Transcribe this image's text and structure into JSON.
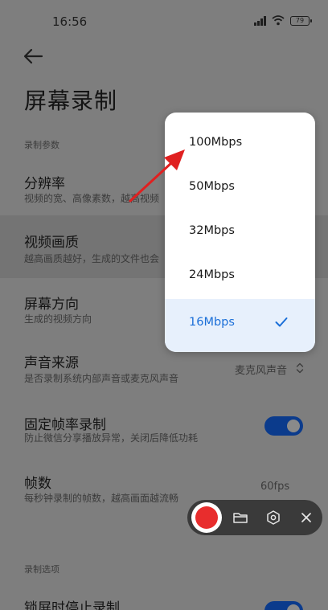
{
  "status_bar": {
    "time": "16:56",
    "battery": "79"
  },
  "page": {
    "title": "屏幕录制"
  },
  "sections": {
    "params_label": "录制参数",
    "options_label": "录制选项"
  },
  "rows": {
    "resolution": {
      "title": "分辨率",
      "desc": "视频的宽、高像素数，越高视频"
    },
    "quality": {
      "title": "视频画质",
      "desc": "越高画质越好，生成的文件也会"
    },
    "orientation": {
      "title": "屏幕方向",
      "desc": "生成的视频方向"
    },
    "audio_source": {
      "title": "声音来源",
      "desc": "是否录制系统内部声音或麦克风声音",
      "value": "麦克风声音"
    },
    "fixed_fps": {
      "title": "固定帧率录制",
      "desc": "防止微信分享播放异常，关闭后降低功耗",
      "enabled": true
    },
    "fps": {
      "title": "帧数",
      "desc": "每秒钟录制的帧数，越高画面越流畅",
      "value": "60fps"
    },
    "lock_stop": {
      "title": "锁屏时停止录制",
      "enabled": true
    }
  },
  "dropdown": {
    "options": [
      {
        "label": "100Mbps",
        "selected": false
      },
      {
        "label": "50Mbps",
        "selected": false
      },
      {
        "label": "32Mbps",
        "selected": false
      },
      {
        "label": "24Mbps",
        "selected": false
      },
      {
        "label": "16Mbps",
        "selected": true
      }
    ]
  },
  "colors": {
    "accent": "#1b6fd8",
    "toggle_on": "#0b3b8c",
    "record": "#e82d2d",
    "annotation_arrow": "#e02020"
  },
  "icons": {
    "back": "arrow-left-icon",
    "signal": "signal-icon",
    "wifi": "wifi-icon",
    "battery": "battery-icon",
    "check": "check-icon",
    "record": "record-icon",
    "folder": "folder-icon",
    "settings": "hexagon-settings-icon",
    "close": "close-icon",
    "annotation": "red-arrow-annotation"
  }
}
